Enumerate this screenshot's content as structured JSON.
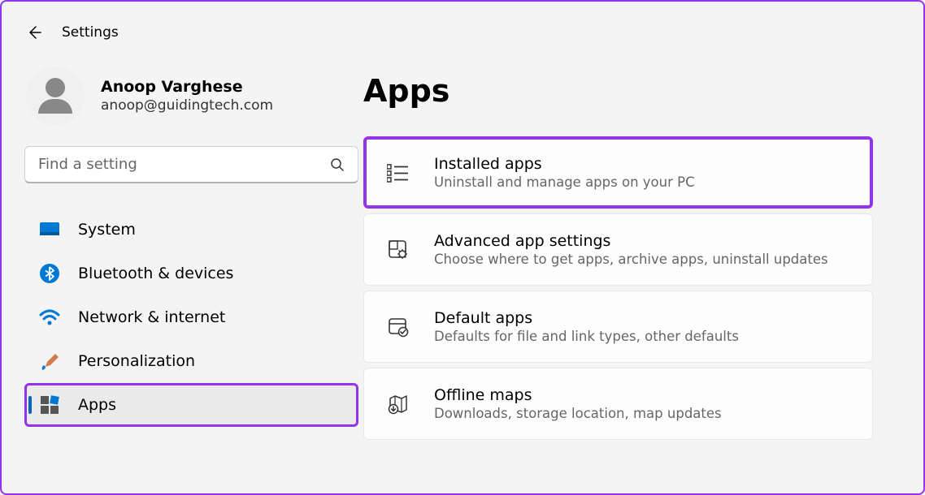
{
  "header": {
    "title": "Settings"
  },
  "profile": {
    "name": "Anoop Varghese",
    "email": "anoop@guidingtech.com"
  },
  "search": {
    "placeholder": "Find a setting"
  },
  "sidebar": {
    "items": [
      {
        "label": "System",
        "icon": "system"
      },
      {
        "label": "Bluetooth & devices",
        "icon": "bluetooth"
      },
      {
        "label": "Network & internet",
        "icon": "wifi"
      },
      {
        "label": "Personalization",
        "icon": "paintbrush"
      },
      {
        "label": "Apps",
        "icon": "apps",
        "selected": true
      }
    ]
  },
  "main": {
    "title": "Apps",
    "cards": [
      {
        "title": "Installed apps",
        "desc": "Uninstall and manage apps on your PC",
        "icon": "installed",
        "highlighted": true
      },
      {
        "title": "Advanced app settings",
        "desc": "Choose where to get apps, archive apps, uninstall updates",
        "icon": "advanced"
      },
      {
        "title": "Default apps",
        "desc": "Defaults for file and link types, other defaults",
        "icon": "default"
      },
      {
        "title": "Offline maps",
        "desc": "Downloads, storage location, map updates",
        "icon": "maps"
      }
    ]
  }
}
